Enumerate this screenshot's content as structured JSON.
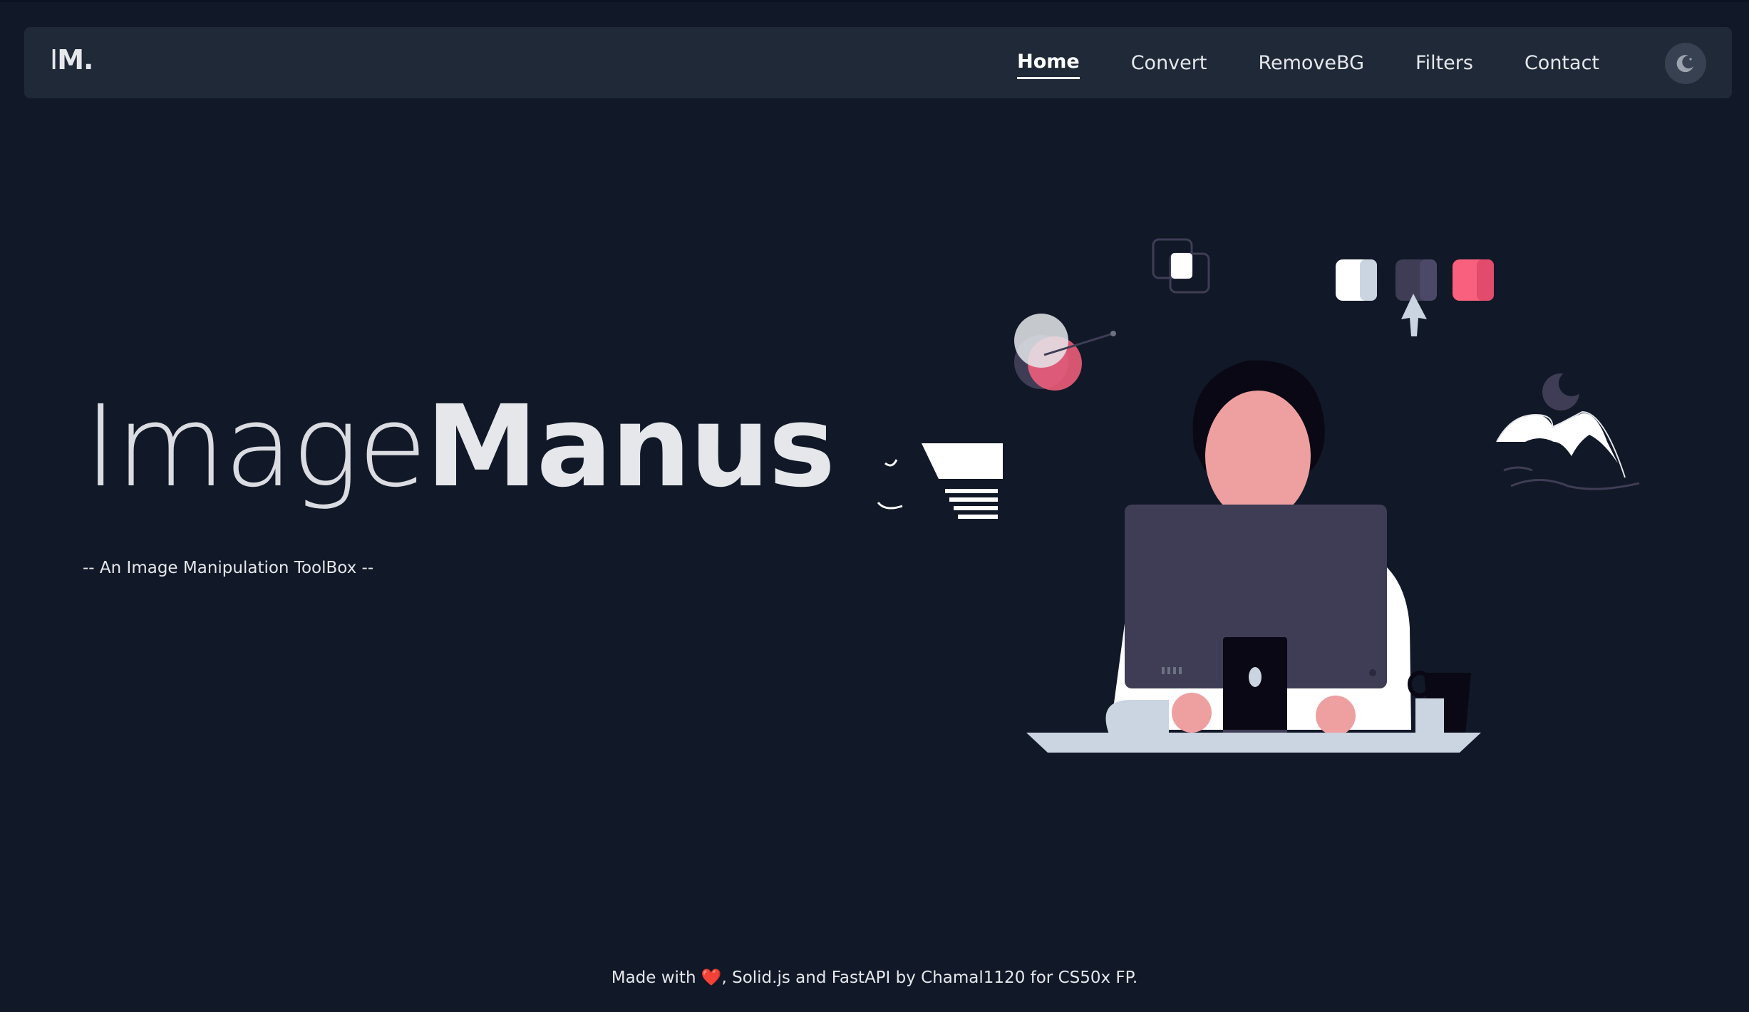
{
  "app": {
    "logo": {
      "bar": "I",
      "letters": "M."
    }
  },
  "nav": {
    "items": [
      {
        "label": "Home",
        "active": true
      },
      {
        "label": "Convert",
        "active": false
      },
      {
        "label": "RemoveBG",
        "active": false
      },
      {
        "label": "Filters",
        "active": false
      },
      {
        "label": "Contact",
        "active": false
      }
    ],
    "theme_toggle_icon": "moon-icon"
  },
  "hero": {
    "title_light": "Image",
    "title_bold": "Manus",
    "subtitle": "-- An Image Manipulation ToolBox --",
    "illustration_icon": "person-at-computer-illustration"
  },
  "footer": {
    "prefix": "Made with",
    "heart": "❤️",
    "suffix": ", Solid.js and FastAPI by Chamal1120 for CS50x FP."
  },
  "colors": {
    "background": "#111827",
    "navbar": "#1f2937",
    "text": "#e5e7eb",
    "accent_pink": "#f9607e",
    "skin": "#ee9fa0",
    "monitor": "#3f3d56"
  }
}
